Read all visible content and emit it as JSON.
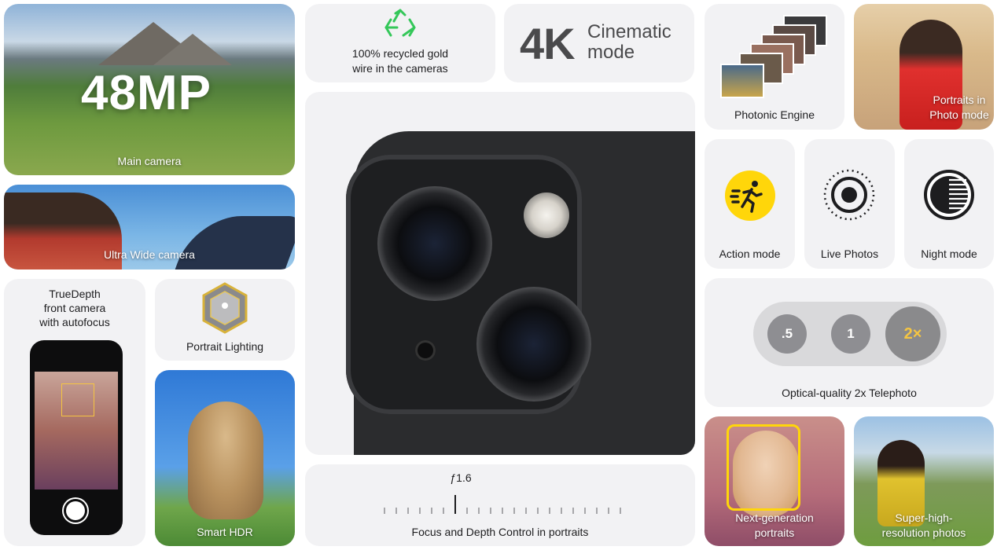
{
  "tiles": {
    "main_camera": {
      "headline": "48MP",
      "label": "Main camera"
    },
    "ultra_wide": {
      "label": "Ultra Wide camera"
    },
    "truedepth": {
      "label_lines": [
        "TrueDepth",
        "front camera",
        "with autofocus"
      ]
    },
    "portrait_lighting": {
      "label": "Portrait Lighting"
    },
    "smart_hdr": {
      "label": "Smart HDR"
    },
    "recycled_gold": {
      "label_lines": [
        "100% recycled gold",
        "wire in the cameras"
      ],
      "icon": "recycle-icon"
    },
    "cinematic": {
      "big": "4K",
      "label_lines": [
        "Cinematic",
        "mode"
      ]
    },
    "focus_depth": {
      "aperture": "ƒ1.6",
      "label": "Focus and Depth Control in portraits"
    },
    "photonic_engine": {
      "label": "Photonic Engine"
    },
    "portraits_photo_mode": {
      "label_lines": [
        "Portraits in",
        "Photo mode"
      ]
    },
    "action_mode": {
      "label": "Action mode",
      "icon": "running-person-icon"
    },
    "live_photos": {
      "label": "Live Photos",
      "icon": "live-photos-icon"
    },
    "night_mode": {
      "label": "Night mode",
      "icon": "night-mode-icon"
    },
    "telephoto": {
      "label": "Optical-quality 2x Telephoto",
      "zoom_options": [
        ".5",
        "1",
        "2×"
      ],
      "selected": "2×"
    },
    "next_gen_portraits": {
      "label_lines": [
        "Next-generation",
        "portraits"
      ]
    },
    "super_high_res": {
      "label_lines": [
        "Super-high-",
        "resolution photos"
      ]
    }
  },
  "colors": {
    "tile_bg": "#f2f2f4",
    "accent_yellow": "#f5c542",
    "action_yellow": "#ffd60a",
    "recycle_green": "#34c759"
  }
}
